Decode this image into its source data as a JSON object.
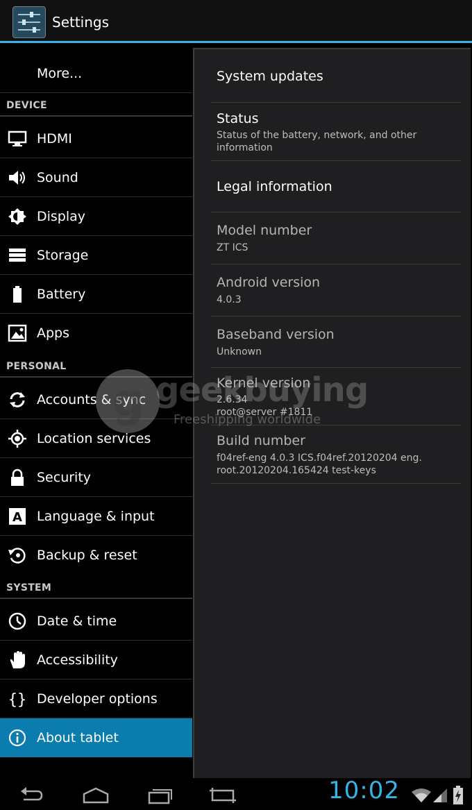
{
  "action_bar": {
    "title": "Settings",
    "icon": "settings-sliders-icon"
  },
  "sidebar": {
    "more_label": "More...",
    "sections": [
      {
        "header": "DEVICE",
        "items": [
          {
            "label": "HDMI",
            "icon": "monitor-icon"
          },
          {
            "label": "Sound",
            "icon": "speaker-icon"
          },
          {
            "label": "Display",
            "icon": "brightness-icon"
          },
          {
            "label": "Storage",
            "icon": "storage-icon"
          },
          {
            "label": "Battery",
            "icon": "battery-icon"
          },
          {
            "label": "Apps",
            "icon": "apps-icon"
          }
        ]
      },
      {
        "header": "PERSONAL",
        "items": [
          {
            "label": "Accounts & sync",
            "icon": "sync-icon"
          },
          {
            "label": "Location services",
            "icon": "location-icon"
          },
          {
            "label": "Security",
            "icon": "lock-icon"
          },
          {
            "label": "Language & input",
            "icon": "keyboard-letter-icon"
          },
          {
            "label": "Backup & reset",
            "icon": "backup-icon"
          }
        ]
      },
      {
        "header": "SYSTEM",
        "items": [
          {
            "label": "Date & time",
            "icon": "clock-icon"
          },
          {
            "label": "Accessibility",
            "icon": "hand-icon"
          },
          {
            "label": "Developer options",
            "icon": "braces-icon"
          },
          {
            "label": "About tablet",
            "icon": "info-icon",
            "selected": true
          }
        ]
      }
    ]
  },
  "about": {
    "items": [
      {
        "title": "System updates"
      },
      {
        "title": "Status",
        "summary": "Status of the battery, network, and other information"
      },
      {
        "title": "Legal information"
      },
      {
        "title": "Model number",
        "summary": "ZT ICS"
      },
      {
        "title": "Android version",
        "summary": "4.0.3"
      },
      {
        "title": "Baseband version",
        "summary": "Unknown"
      },
      {
        "title": "Kernel version",
        "summary": "2.6.34\nroot@server #1811"
      },
      {
        "title": "Build number",
        "summary": "f04ref-eng 4.0.3 ICS.f04ref.20120204 eng.\nroot.20120204.165424 test-keys"
      }
    ]
  },
  "watermark": {
    "brand": "geekbuying",
    "tagline": "Freeshipping worldwide"
  },
  "system_bar": {
    "time": "10:02",
    "nav": [
      "back-icon",
      "home-icon",
      "recent-apps-icon",
      "screenshot-icon"
    ],
    "status": [
      "wifi-icon",
      "signal-icon",
      "battery-charging-icon"
    ]
  },
  "colors": {
    "accent": "#33b5e5",
    "selected": "#0a7dae"
  }
}
